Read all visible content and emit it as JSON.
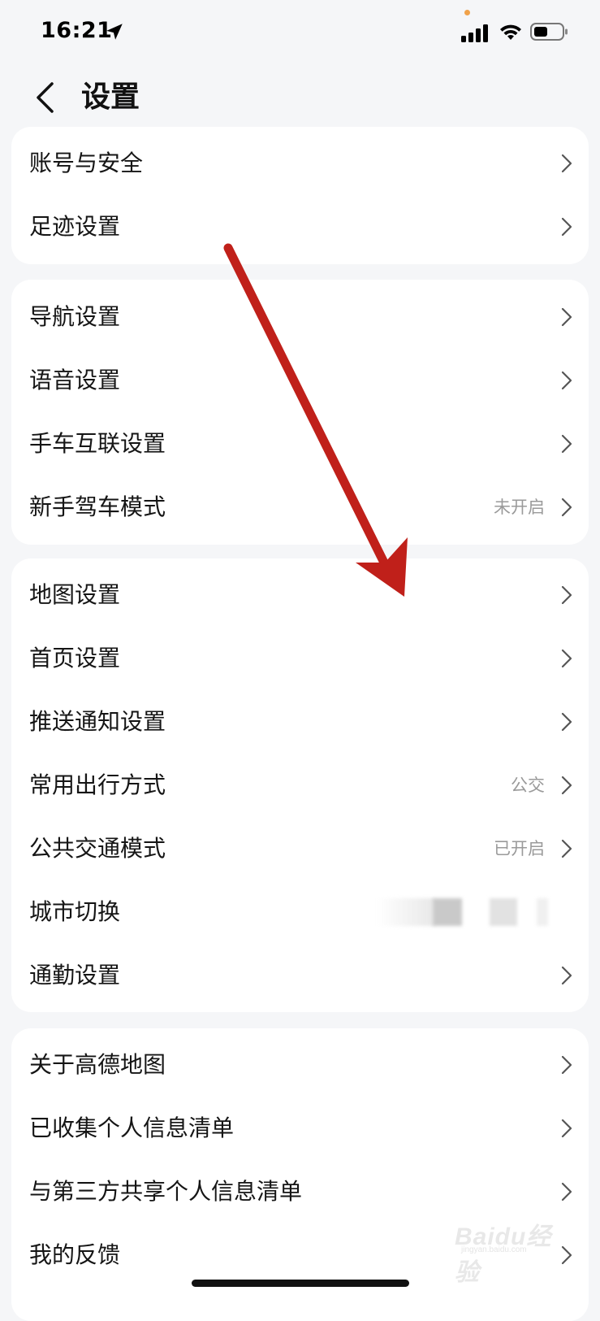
{
  "status_bar": {
    "time": "16:21",
    "icons": [
      "location-arrow-icon",
      "signal-icon",
      "wifi-icon",
      "battery-icon"
    ],
    "camera_dot_color": "#f0a24a"
  },
  "header": {
    "title": "设置",
    "back_icon": "chevron-left-icon"
  },
  "groups": [
    {
      "items": [
        {
          "label": "账号与安全",
          "value": ""
        },
        {
          "label": "足迹设置",
          "value": ""
        }
      ]
    },
    {
      "items": [
        {
          "label": "导航设置",
          "value": ""
        },
        {
          "label": "语音设置",
          "value": ""
        },
        {
          "label": "手车互联设置",
          "value": ""
        },
        {
          "label": "新手驾车模式",
          "value": "未开启"
        }
      ]
    },
    {
      "items": [
        {
          "label": "地图设置",
          "value": ""
        },
        {
          "label": "首页设置",
          "value": ""
        },
        {
          "label": "推送通知设置",
          "value": ""
        },
        {
          "label": "常用出行方式",
          "value": "公交"
        },
        {
          "label": "公共交通模式",
          "value": "已开启"
        },
        {
          "label": "城市切换",
          "value": ""
        },
        {
          "label": "通勤设置",
          "value": ""
        }
      ]
    },
    {
      "items": [
        {
          "label": "关于高德地图",
          "value": ""
        },
        {
          "label": "已收集个人信息清单",
          "value": ""
        },
        {
          "label": "与第三方共享个人信息清单",
          "value": ""
        },
        {
          "label": "我的反馈",
          "value": ""
        }
      ]
    }
  ],
  "annotation": {
    "arrow_color": "#c0201a"
  },
  "watermark": {
    "text": "Baidu经验",
    "sub": "jingyan.baidu.com"
  }
}
